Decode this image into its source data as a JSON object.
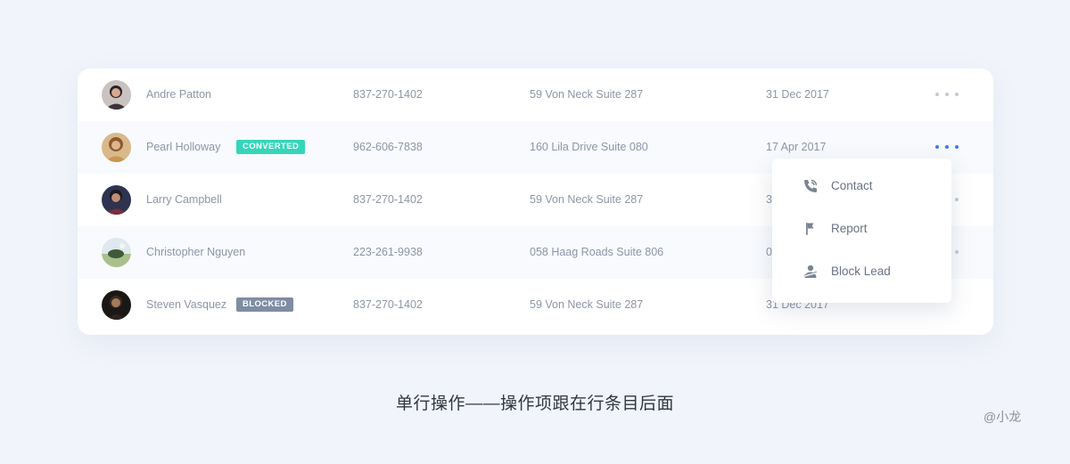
{
  "rows": [
    {
      "name": "Andre Patton",
      "badge": "",
      "phone": "837-270-1402",
      "address": "59 Von Neck Suite 287",
      "date": "31 Dec 2017"
    },
    {
      "name": "Pearl Holloway",
      "badge": "CONVERTED",
      "phone": "962-606-7838",
      "address": "160 Lila Drive Suite 080",
      "date": "17 Apr 2017"
    },
    {
      "name": "Larry Campbell",
      "badge": "",
      "phone": "837-270-1402",
      "address": "59 Von Neck Suite 287",
      "date": "3"
    },
    {
      "name": "Christopher Nguyen",
      "badge": "",
      "phone": "223-261-9938",
      "address": "058 Haag Roads Suite 806",
      "date": "0"
    },
    {
      "name": "Steven Vasquez",
      "badge": "BLOCKED",
      "phone": "837-270-1402",
      "address": "59 Von Neck Suite 287",
      "date": "31 Dec 2017"
    }
  ],
  "menu": {
    "items": [
      {
        "label": "Contact",
        "icon": "phone-call-icon"
      },
      {
        "label": "Report",
        "icon": "flag-icon"
      },
      {
        "label": "Block Lead",
        "icon": "block-user-icon"
      }
    ]
  },
  "caption": "单行操作——操作项跟在行条目后面",
  "signature": "@小龙",
  "colors": {
    "background": "#f1f4fa",
    "badge_converted": "#34d6b9",
    "badge_blocked": "#7f8da3",
    "active_dots": "#3b7cf3",
    "text": "#8d95a5"
  }
}
